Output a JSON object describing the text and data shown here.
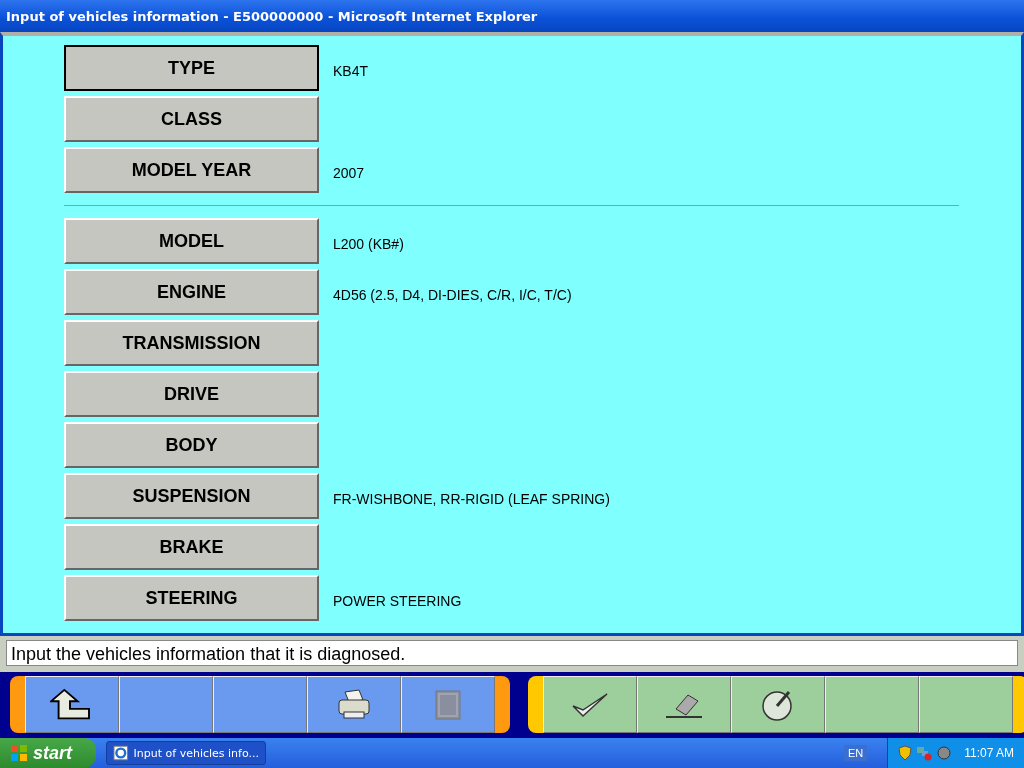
{
  "window": {
    "title": "Input of vehicles information - E500000000 - Microsoft Internet Explorer"
  },
  "field_groups": [
    {
      "fields": [
        {
          "label": "TYPE",
          "value": "KB4T",
          "selected": true
        },
        {
          "label": "CLASS",
          "selected": false
        },
        {
          "label": "MODEL YEAR",
          "value": "2007",
          "selected": false
        }
      ]
    },
    {
      "fields": [
        {
          "label": "MODEL",
          "value": "L200 (KB#)",
          "selected": false
        },
        {
          "label": "ENGINE",
          "value": "4D56 (2.5, D4, DI-DIES, C/R, I/C, T/C)",
          "selected": false
        },
        {
          "label": "TRANSMISSION",
          "selected": false
        },
        {
          "label": "DRIVE",
          "selected": false
        },
        {
          "label": "BODY",
          "selected": false
        },
        {
          "label": "SUSPENSION",
          "value": "FR-WISHBONE, RR-RIGID (LEAF SPRING)",
          "selected": false
        },
        {
          "label": "BRAKE",
          "selected": false
        },
        {
          "label": "STEERING",
          "value": "POWER STEERING",
          "selected": false
        }
      ]
    }
  ],
  "message": "Input the vehicles information that it is diagnosed.",
  "left_toolbar": [
    {
      "kind": "back"
    },
    {
      "kind": "empty"
    },
    {
      "kind": "empty"
    },
    {
      "kind": "print"
    },
    {
      "kind": "help"
    }
  ],
  "right_toolbar": [
    {
      "kind": "check"
    },
    {
      "kind": "erase"
    },
    {
      "kind": "gauge"
    },
    {
      "kind": "empty"
    },
    {
      "kind": "empty"
    }
  ],
  "taskbar": {
    "start": "start",
    "task": "Input of vehicles info...",
    "language": "EN",
    "clock": "11:07 AM"
  }
}
